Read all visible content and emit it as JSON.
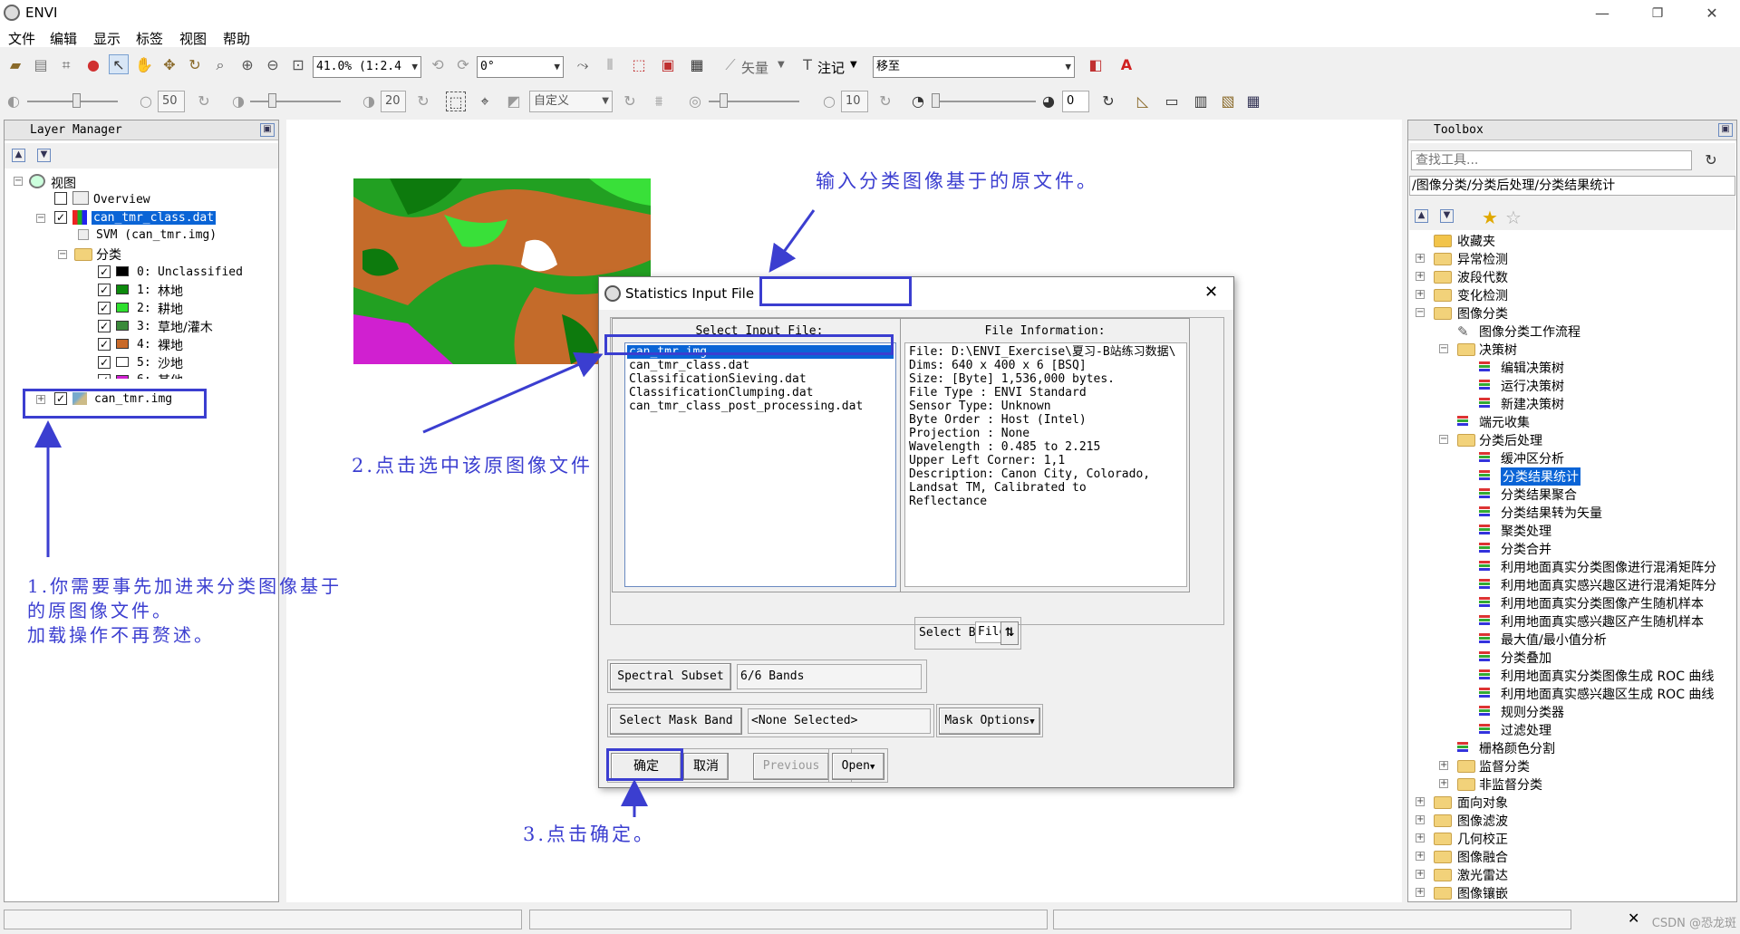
{
  "window": {
    "title": "ENVI",
    "minimize": "—",
    "maximize": "❐",
    "close": "✕"
  },
  "menu": [
    "文件",
    "编辑",
    "显示",
    "标签",
    "视图",
    "帮助"
  ],
  "toolbar": {
    "zoom_value": "41.0% (1:2.4",
    "rotation_value": "0°",
    "vector_label": "矢量",
    "annotation_label": "注记",
    "goto_value": "移至",
    "brightness_value": "50",
    "contrast_value": "20",
    "stretch_value": "自定义",
    "sharpen_value": "10",
    "transparency_value": "0"
  },
  "layer_manager": {
    "title": "Layer Manager",
    "root": "视图",
    "overview": "Overview",
    "class_file": "can_tmr_class.dat",
    "svm_label": "SVM (can_tmr.img)",
    "classes_folder": "分类",
    "classes": [
      {
        "id": "0:",
        "name": "Unclassified",
        "color": "#000000"
      },
      {
        "id": "1:",
        "name": "林地",
        "color": "#0c8a0c"
      },
      {
        "id": "2:",
        "name": "耕地",
        "color": "#2ee02e"
      },
      {
        "id": "3:",
        "name": "草地/灌木",
        "color": "#3a8a3a"
      },
      {
        "id": "4:",
        "name": "裸地",
        "color": "#c86a2a"
      },
      {
        "id": "5:",
        "name": "沙地",
        "color": "#ffffff"
      },
      {
        "id": "6:",
        "name": "其他",
        "color": "#d020d0"
      }
    ],
    "image_file": "can_tmr.img"
  },
  "toolbox": {
    "title": "Toolbox",
    "search_placeholder": "查找工具...",
    "path": "/图像分类/分类后处理/分类结果统计",
    "top_items": [
      "收藏夹",
      "异常检测",
      "波段代数",
      "变化检测",
      "图像分类"
    ],
    "classification_children": [
      "图像分类工作流程",
      "决策树"
    ],
    "decision_tree_children": [
      "编辑决策树",
      "运行决策树",
      "新建决策树"
    ],
    "endmember": "端元收集",
    "post_processing": "分类后处理",
    "post_children": [
      "缓冲区分析",
      "分类结果统计",
      "分类结果聚合",
      "分类结果转为矢量",
      "聚类处理",
      "分类合并",
      "利用地面真实分类图像进行混淆矩阵分",
      "利用地面真实感兴趣区进行混淆矩阵分",
      "利用地面真实分类图像产生随机样本",
      "利用地面真实感兴趣区产生随机样本",
      "最大值/最小值分析",
      "分类叠加",
      "利用地面真实分类图像生成 ROC 曲线",
      "利用地面真实感兴趣区生成 ROC 曲线",
      "规则分类器",
      "过滤处理"
    ],
    "after_post": [
      "栅格颜色分割",
      "监督分类",
      "非监督分类"
    ],
    "bottom_items": [
      "面向对象",
      "图像滤波",
      "几何校正",
      "图像融合",
      "激光雷达",
      "图像镶嵌"
    ]
  },
  "dialog": {
    "title": "Statistics Input File",
    "close": "✕",
    "select_header": "Select Input File:",
    "files": [
      "can_tmr.img",
      "can_tmr_class.dat",
      "ClassificationSieving.dat",
      "ClassificationClumping.dat",
      "can_tmr_class_post_processing.dat"
    ],
    "info_header": "File Information:",
    "info_lines": [
      "File: D:\\ENVI_Exercise\\夏习-B站练习数据\\",
      "Dims: 640 x 400 x 6 [BSQ]",
      "Size: [Byte] 1,536,000 bytes.",
      "File Type  : ENVI Standard",
      "Sensor Type: Unknown",
      "Byte Order : Host (Intel)",
      "Projection : None",
      "Wavelength : 0.485 to 2.215",
      "Upper Left Corner: 1,1",
      "Description: Canon City, Colorado,",
      "Landsat TM, Calibrated to",
      "Reflectance"
    ],
    "select_by_label": "Select By",
    "select_by_value": "File",
    "spectral_subset_btn": "Spectral Subset",
    "spectral_subset_value": "6/6 Bands",
    "mask_band_btn": "Select Mask Band",
    "mask_band_value": "<None Selected>",
    "mask_options_btn": "Mask Options",
    "ok_btn": "确定",
    "cancel_btn": "取消",
    "previous_btn": "Previous",
    "open_btn": "Open"
  },
  "annotations": {
    "top": "输入分类图像基于的原文件。",
    "step2": "2.点击选中该原图像文件",
    "step1_line1": "1.你需要事先加进来分类图像基于",
    "step1_line2": "的原图像文件。",
    "step1_line3": "加载操作不再赘述。",
    "step3": "3.点击确定。"
  },
  "status": {
    "watermark": "CSDN @恐龙斑"
  },
  "colors": {
    "annotation": "#3b3ed0",
    "selection": "#0a64d6"
  }
}
